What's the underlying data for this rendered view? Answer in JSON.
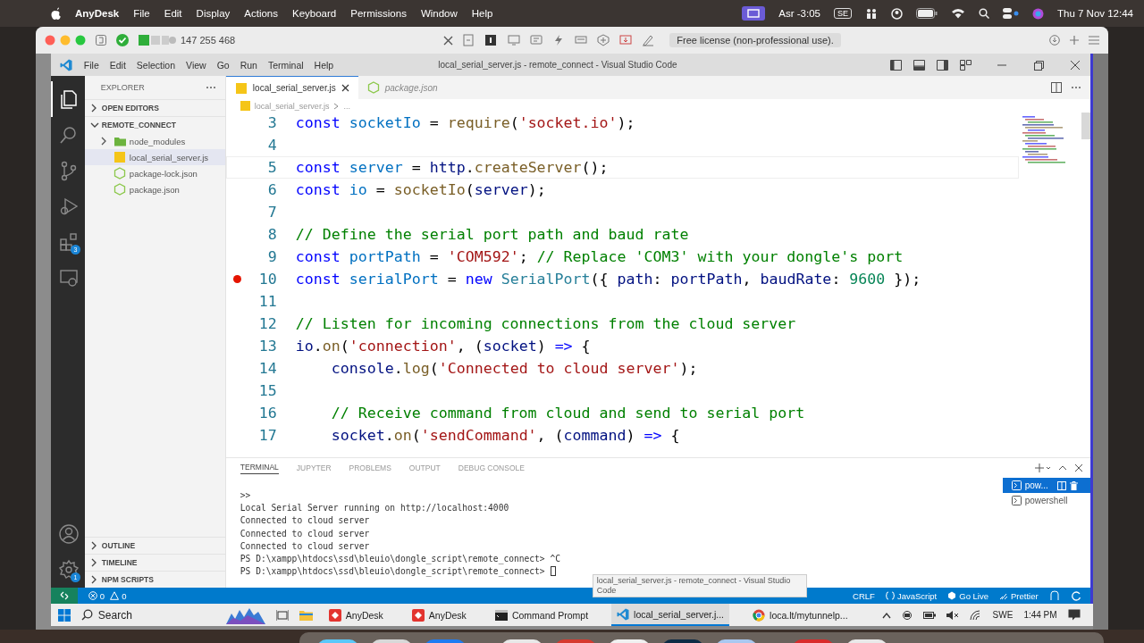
{
  "mac_menubar": {
    "app": "AnyDesk",
    "menus": [
      "File",
      "Edit",
      "Display",
      "Actions",
      "Keyboard",
      "Permissions",
      "Window",
      "Help"
    ],
    "prayer_time": "Asr -3:05",
    "input_source": "SE",
    "clock": "Thu 7 Nov 12:44"
  },
  "anydesk_toolbar": {
    "address": "147 255 468",
    "license_notice": "Free license (non-professional use)."
  },
  "vscode": {
    "menus": [
      "File",
      "Edit",
      "Selection",
      "View",
      "Go",
      "Run",
      "Terminal",
      "Help"
    ],
    "title": "local_serial_server.js - remote_connect - Visual Studio Code",
    "activity_bar": {
      "items": [
        {
          "kind": "explorer",
          "selected": true
        },
        {
          "kind": "search",
          "selected": false
        },
        {
          "kind": "source-control",
          "selected": false
        },
        {
          "kind": "run-debug",
          "selected": false
        },
        {
          "kind": "extensions",
          "selected": false,
          "badge": "3"
        },
        {
          "kind": "remote",
          "selected": false
        }
      ],
      "bottom": [
        {
          "kind": "account"
        },
        {
          "kind": "settings",
          "badge": "1"
        }
      ]
    },
    "sidebar": {
      "title": "EXPLORER",
      "sections": [
        {
          "label": "OPEN EDITORS",
          "expanded": false
        },
        {
          "label": "REMOTE_CONNECT",
          "expanded": true,
          "children": [
            {
              "label": "node_modules",
              "kind": "folder",
              "expanded": false,
              "selected": false
            },
            {
              "label": "local_serial_server.js",
              "kind": "js",
              "selected": true
            },
            {
              "label": "package-lock.json",
              "kind": "json",
              "selected": false
            },
            {
              "label": "package.json",
              "kind": "json",
              "selected": false
            }
          ]
        }
      ],
      "bottom_sections": [
        {
          "label": "OUTLINE",
          "expanded": false
        },
        {
          "label": "TIMELINE",
          "expanded": false
        },
        {
          "label": "NPM SCRIPTS",
          "expanded": false
        }
      ]
    },
    "tabs": [
      {
        "label": "local_serial_server.js",
        "kind": "js",
        "selected": true,
        "preview": false
      },
      {
        "label": "package.json",
        "kind": "json",
        "selected": false,
        "preview": true
      }
    ],
    "breadcrumb": [
      "local_serial_server.js",
      "..."
    ],
    "editor_lines": [
      {
        "number": "3",
        "tokens": [
          {
            "kind": "keyword",
            "text": "const"
          },
          {
            "kind": "constant",
            "text": " socketIo"
          },
          {
            "kind": "plain",
            "text": " = "
          },
          {
            "kind": "function",
            "text": "require"
          },
          {
            "kind": "plain",
            "text": "("
          },
          {
            "kind": "string",
            "text": "'socket.io'"
          },
          {
            "kind": "plain",
            "text": ");"
          }
        ]
      },
      {
        "number": "4"
      },
      {
        "number": "5",
        "current": true,
        "tokens": [
          {
            "kind": "keyword",
            "text": "const"
          },
          {
            "kind": "constant",
            "text": " server"
          },
          {
            "kind": "plain",
            "text": " = "
          },
          {
            "kind": "variable",
            "text": "http"
          },
          {
            "kind": "plain",
            "text": "."
          },
          {
            "kind": "function",
            "text": "createServer"
          },
          {
            "kind": "plain",
            "text": "();"
          }
        ]
      },
      {
        "number": "6",
        "tokens": [
          {
            "kind": "keyword",
            "text": "const"
          },
          {
            "kind": "constant",
            "text": " io"
          },
          {
            "kind": "plain",
            "text": " = "
          },
          {
            "kind": "function",
            "text": "socketIo"
          },
          {
            "kind": "plain",
            "text": "("
          },
          {
            "kind": "variable",
            "text": "server"
          },
          {
            "kind": "plain",
            "text": ");"
          }
        ]
      },
      {
        "number": "7"
      },
      {
        "number": "8",
        "tokens": [
          {
            "kind": "comment",
            "text": "// Define the serial port path and baud rate"
          }
        ]
      },
      {
        "number": "9",
        "tokens": [
          {
            "kind": "keyword",
            "text": "const"
          },
          {
            "kind": "constant",
            "text": " portPath"
          },
          {
            "kind": "plain",
            "text": " = "
          },
          {
            "kind": "string",
            "text": "'COM592'"
          },
          {
            "kind": "plain",
            "text": ";"
          },
          {
            "kind": "comment",
            "text": " // Replace 'COM3' with your dongle's port"
          }
        ]
      },
      {
        "number": "10",
        "breakpoint": true,
        "tokens": [
          {
            "kind": "keyword",
            "text": "const"
          },
          {
            "kind": "constant",
            "text": " serialPort"
          },
          {
            "kind": "plain",
            "text": " = "
          },
          {
            "kind": "keyword",
            "text": "new"
          },
          {
            "kind": "class",
            "text": " SerialPort"
          },
          {
            "kind": "plain",
            "text": "({ "
          },
          {
            "kind": "variable",
            "text": "path"
          },
          {
            "kind": "plain",
            "text": ": "
          },
          {
            "kind": "variable",
            "text": "portPath"
          },
          {
            "kind": "plain",
            "text": ", "
          },
          {
            "kind": "variable",
            "text": "baudRate"
          },
          {
            "kind": "plain",
            "text": ": "
          },
          {
            "kind": "number",
            "text": "9600"
          },
          {
            "kind": "plain",
            "text": " });"
          }
        ]
      },
      {
        "number": "11"
      },
      {
        "number": "12",
        "tokens": [
          {
            "kind": "comment",
            "text": "// Listen for incoming connections from the cloud server"
          }
        ]
      },
      {
        "number": "13",
        "tokens": [
          {
            "kind": "variable",
            "text": "io"
          },
          {
            "kind": "plain",
            "text": "."
          },
          {
            "kind": "function",
            "text": "on"
          },
          {
            "kind": "plain",
            "text": "("
          },
          {
            "kind": "string",
            "text": "'connection'"
          },
          {
            "kind": "plain",
            "text": ", ("
          },
          {
            "kind": "variable",
            "text": "socket"
          },
          {
            "kind": "plain",
            "text": ") "
          },
          {
            "kind": "keyword",
            "text": "=>"
          },
          {
            "kind": "plain",
            "text": " {"
          }
        ]
      },
      {
        "number": "14",
        "tokens": [
          {
            "kind": "variable",
            "text": "    console"
          },
          {
            "kind": "plain",
            "text": "."
          },
          {
            "kind": "function",
            "text": "log"
          },
          {
            "kind": "plain",
            "text": "("
          },
          {
            "kind": "string",
            "text": "'Connected to cloud server'"
          },
          {
            "kind": "plain",
            "text": ");"
          }
        ]
      },
      {
        "number": "15"
      },
      {
        "number": "16",
        "tokens": [
          {
            "kind": "comment",
            "text": "    // Receive command from cloud and send to serial port"
          }
        ]
      },
      {
        "number": "17",
        "tokens": [
          {
            "kind": "variable",
            "text": "    socket"
          },
          {
            "kind": "plain",
            "text": "."
          },
          {
            "kind": "function",
            "text": "on"
          },
          {
            "kind": "plain",
            "text": "("
          },
          {
            "kind": "string",
            "text": "'sendCommand'"
          },
          {
            "kind": "plain",
            "text": ", ("
          },
          {
            "kind": "variable",
            "text": "command"
          },
          {
            "kind": "plain",
            "text": ") "
          },
          {
            "kind": "keyword",
            "text": "=>"
          },
          {
            "kind": "plain",
            "text": " {"
          }
        ]
      }
    ],
    "panel": {
      "tabs": [
        {
          "label": "TERMINAL",
          "selected": true
        },
        {
          "label": "JUPYTER",
          "selected": false
        },
        {
          "label": "PROBLEMS",
          "selected": false
        },
        {
          "label": "OUTPUT",
          "selected": false
        },
        {
          "label": "DEBUG CONSOLE",
          "selected": false
        }
      ],
      "terminal_lines": [
        {
          "text": ">>"
        },
        {
          "text": "Local Serial Server running on http://localhost:4000"
        },
        {
          "text": "Connected to cloud server"
        },
        {
          "text": "Connected to cloud server"
        },
        {
          "text": "Connected to cloud server"
        },
        {
          "text": "PS D:\\xampp\\htdocs\\ssd\\bleuio\\dongle_script\\remote_connect> ^C"
        },
        {
          "text": "PS D:\\xampp\\htdocs\\ssd\\bleuio\\dongle_script\\remote_connect>",
          "cursor": true
        }
      ],
      "terminals": [
        {
          "label": "pow...",
          "selected": true
        },
        {
          "label": "powershell",
          "selected": false
        }
      ]
    },
    "tooltip": "local_serial_server.js - remote_connect - Visual Studio Code",
    "status_bar": {
      "errors": "0",
      "warnings": "0",
      "items": [
        {
          "kind": "eol",
          "text": "CRLF"
        },
        {
          "kind": "language",
          "text": "JavaScript"
        },
        {
          "kind": "go-live",
          "text": "Go Live"
        },
        {
          "kind": "prettier",
          "text": "Prettier"
        }
      ]
    }
  },
  "taskbar": {
    "search": "Search",
    "apps": [
      {
        "kind": "anydesk",
        "label": "AnyDesk",
        "selected": false
      },
      {
        "kind": "anydesk",
        "label": "AnyDesk",
        "selected": false
      },
      {
        "kind": "terminal",
        "label": "Command Prompt",
        "selected": false
      },
      {
        "kind": "vscode",
        "label": "local_serial_server.j...",
        "selected": true
      },
      {
        "kind": "browser",
        "label": "loca.lt/mytunnelp...",
        "selected": false
      }
    ],
    "language": "SWE",
    "time": "1:44 PM"
  }
}
